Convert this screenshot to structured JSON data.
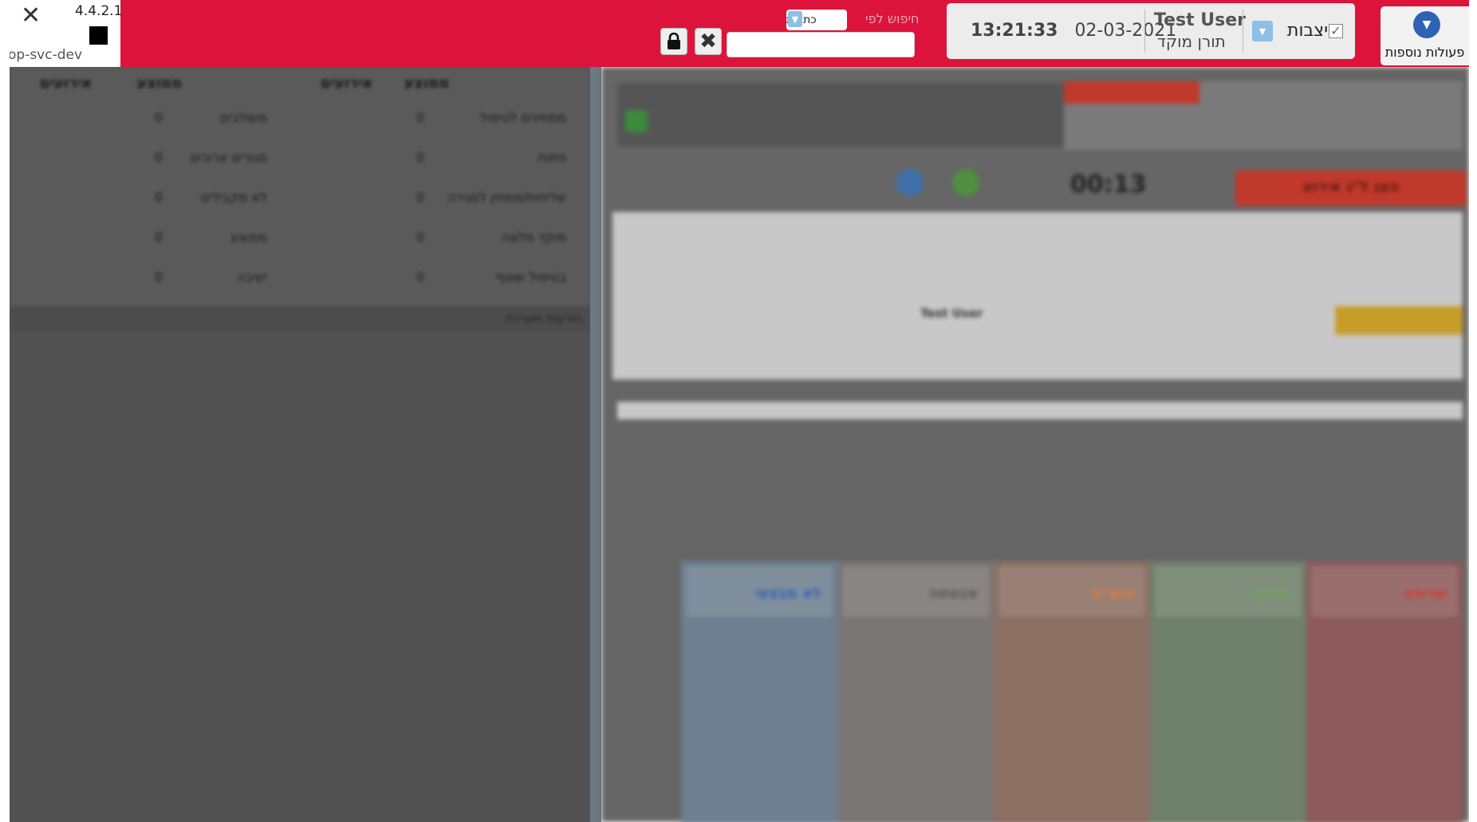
{
  "app": {
    "version": "4.4.2.1",
    "environment": "op-svc-dev",
    "close_glyph": "✕",
    "lock_glyph": "🔒",
    "clear_glyph": "✖"
  },
  "search": {
    "label": "חיפוש לפי",
    "by_value": "כתובת",
    "input_value": "",
    "placeholder": ""
  },
  "status": {
    "date": "02-03-2021",
    "time": "13:21:33",
    "user_name": "Test User",
    "user_role": "תורן מוקד",
    "duty_label": "ניצבות",
    "duty_checked": true
  },
  "actions": {
    "more_label": "פעולות נוספות"
  },
  "stats": {
    "headers": [
      "אירועים",
      "ממוצע",
      "אירועים",
      "ממוצע"
    ],
    "left_rows": [
      {
        "label": "ממתינים לטיפול",
        "value": "0"
      },
      {
        "label": "פתוח",
        "value": "0"
      },
      {
        "label": "שליחות/ממתין לסגירה",
        "value": "0"
      },
      {
        "label": "מוקד פלוגה",
        "value": "0"
      },
      {
        "label": "בטיפול שוטף",
        "value": "0"
      }
    ],
    "right_rows": [
      {
        "label": "משולבים",
        "value": "0"
      },
      {
        "label": "סגורים ארוכים",
        "value": "0"
      },
      {
        "label": "לא מקבילים",
        "value": "0"
      },
      {
        "label": "ממוצע",
        "value": "0"
      },
      {
        "label": "ישיבה",
        "value": "0"
      }
    ],
    "footer_label": "הודעות מערכת"
  },
  "incident": {
    "timer": "00:13",
    "banner_label": "הצג ל\"ג אירוע",
    "caller_label": "Test User",
    "categories": [
      {
        "name": "שריפה",
        "color": "#d3392b"
      },
      {
        "name": "חילוץ",
        "color": "#6aa84f"
      },
      {
        "name": "חומ\"ס",
        "color": "#e07b39"
      },
      {
        "name": "אבטחה",
        "color": "#8a8a8a"
      },
      {
        "name": "לא מבצעי",
        "color": "#2e62b3"
      }
    ]
  },
  "colors": {
    "topbar": "#dc143c",
    "accent_blue": "#2e62b3",
    "panel_bg": "#ececec"
  }
}
